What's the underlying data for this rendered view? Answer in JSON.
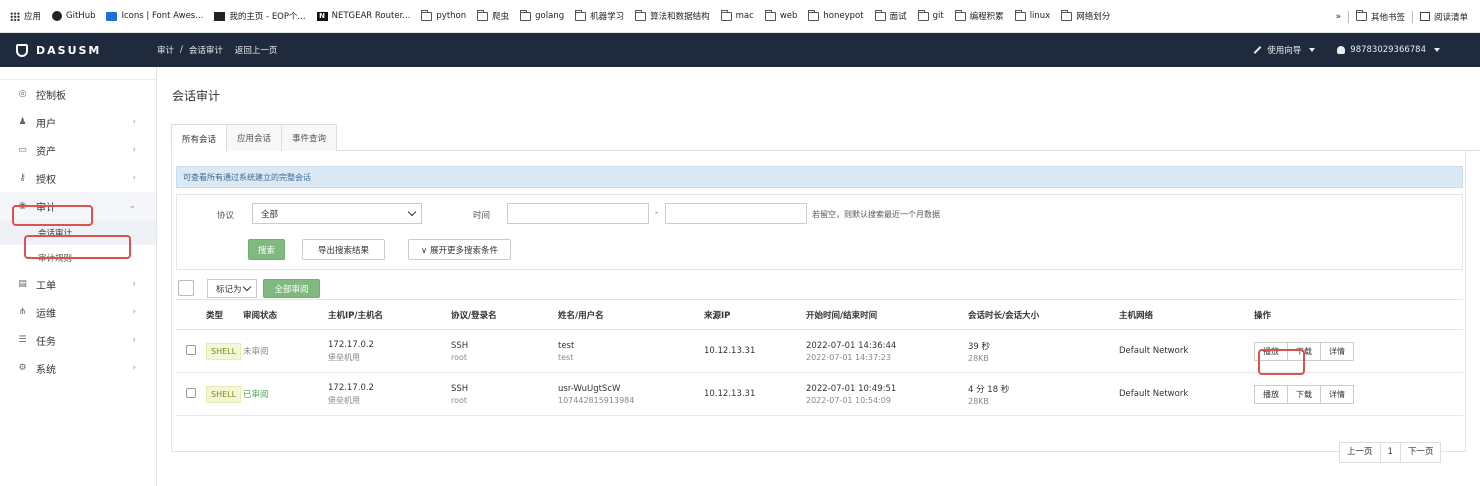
{
  "bookmarks": [
    {
      "icon": "apps-grid-icon",
      "label": "应用"
    },
    {
      "icon": "github-icon",
      "label": "GitHub"
    },
    {
      "icon": "font-awesome-icon",
      "label": "Icons | Font Awes..."
    },
    {
      "icon": "eop-icon",
      "label": "我的主页 - EOP个..."
    },
    {
      "icon": "netgear-icon",
      "label": "NETGEAR Router..."
    },
    {
      "icon": "folder-icon",
      "label": "python"
    },
    {
      "icon": "folder-icon",
      "label": "爬虫"
    },
    {
      "icon": "folder-icon",
      "label": "golang"
    },
    {
      "icon": "folder-icon",
      "label": "机器学习"
    },
    {
      "icon": "folder-icon",
      "label": "算法和数据结构"
    },
    {
      "icon": "folder-icon",
      "label": "mac"
    },
    {
      "icon": "folder-icon",
      "label": "web"
    },
    {
      "icon": "folder-icon",
      "label": "honeypot"
    },
    {
      "icon": "folder-icon",
      "label": "面试"
    },
    {
      "icon": "folder-icon",
      "label": "git"
    },
    {
      "icon": "folder-icon",
      "label": "编程积累"
    },
    {
      "icon": "folder-icon",
      "label": "linux"
    },
    {
      "icon": "folder-icon",
      "label": "网络划分"
    }
  ],
  "bookmarks_right": {
    "more": "»",
    "other": "其他书签",
    "reading": "阅读清单"
  },
  "topnav": {
    "logo": "DASUSM",
    "breadcrumb": [
      "审计",
      "/",
      "会话审计",
      "返回上一页"
    ],
    "guide": "使用向导",
    "user": "98783029366784"
  },
  "sidebar": {
    "items": [
      {
        "icon": "dashboard-icon",
        "glyph": "◎",
        "label": "控制板",
        "arrow": ""
      },
      {
        "icon": "user-icon",
        "glyph": "♟",
        "label": "用户",
        "arrow": "›"
      },
      {
        "icon": "monitor-icon",
        "glyph": "▭",
        "label": "资产",
        "arrow": "›"
      },
      {
        "icon": "key-icon",
        "glyph": "⚷",
        "label": "授权",
        "arrow": "›"
      },
      {
        "icon": "eye-icon",
        "glyph": "◉",
        "label": "审计",
        "arrow": "⌄"
      }
    ],
    "audit_sub": [
      "会话审计",
      "审计规则"
    ],
    "items_after": [
      {
        "icon": "ticket-icon",
        "glyph": "▤",
        "label": "工单",
        "arrow": "›"
      },
      {
        "icon": "sitemap-icon",
        "glyph": "⋔",
        "label": "运维",
        "arrow": "›"
      },
      {
        "icon": "tasks-icon",
        "glyph": "☰",
        "label": "任务",
        "arrow": "›"
      },
      {
        "icon": "gear-icon",
        "glyph": "⚙",
        "label": "系统",
        "arrow": "›"
      }
    ]
  },
  "main": {
    "title": "会话审计",
    "tabs": [
      "所有会话",
      "应用会话",
      "事件查询"
    ],
    "info": "可查看所有通过系统建立的完整会话",
    "search": {
      "protocol_label": "协议",
      "protocol_value": "全部",
      "time_label": "时间",
      "time_dash": "-",
      "time_hint": "若留空，则默认搜索最近一个月数据",
      "search_btn": "搜索",
      "export_btn": "导出搜索结果",
      "more_btn": "∨ 展开更多搜索条件"
    },
    "toolbar": {
      "mark_as": "标记为",
      "review_all": "全部审阅"
    },
    "table": {
      "headers": [
        "类型",
        "审阅状态",
        "主机IP/主机名",
        "协议/登录名",
        "姓名/用户名",
        "来源IP",
        "开始时间/结束时间",
        "会话时长/会话大小",
        "主机网络",
        "操作"
      ],
      "rows": [
        {
          "type": "SHELL",
          "status": "未审阅",
          "status_kind": "unreviewed",
          "ip": "172.17.0.2",
          "host": "堡垒机用",
          "proto": "SSH",
          "login": "root",
          "name": "test",
          "username": "test",
          "src": "10.12.13.31",
          "start": "2022-07-01 14:36:44",
          "end": "2022-07-01 14:37:23",
          "duration": "39 秒",
          "size": "28KB",
          "network": "Default Network"
        },
        {
          "type": "SHELL",
          "status": "已审阅",
          "status_kind": "reviewed",
          "ip": "172.17.0.2",
          "host": "堡垒机用",
          "proto": "SSH",
          "login": "root",
          "name": "usr-WuUgtScW",
          "username": "107442815913984",
          "src": "10.12.13.31",
          "start": "2022-07-01 10:49:51",
          "end": "2022-07-01 10:54:09",
          "duration": "4 分 18 秒",
          "size": "28KB",
          "network": "Default Network"
        }
      ],
      "ops": [
        "播放",
        "下载",
        "详情"
      ]
    },
    "pager": {
      "prev": "上一页",
      "page": "1",
      "next": "下一页"
    }
  },
  "colors": {
    "nav_bg": "#1f2b3d",
    "green": "#7fb97f",
    "highlight_red": "#d9534f",
    "info_bg": "#dbe9f5"
  }
}
